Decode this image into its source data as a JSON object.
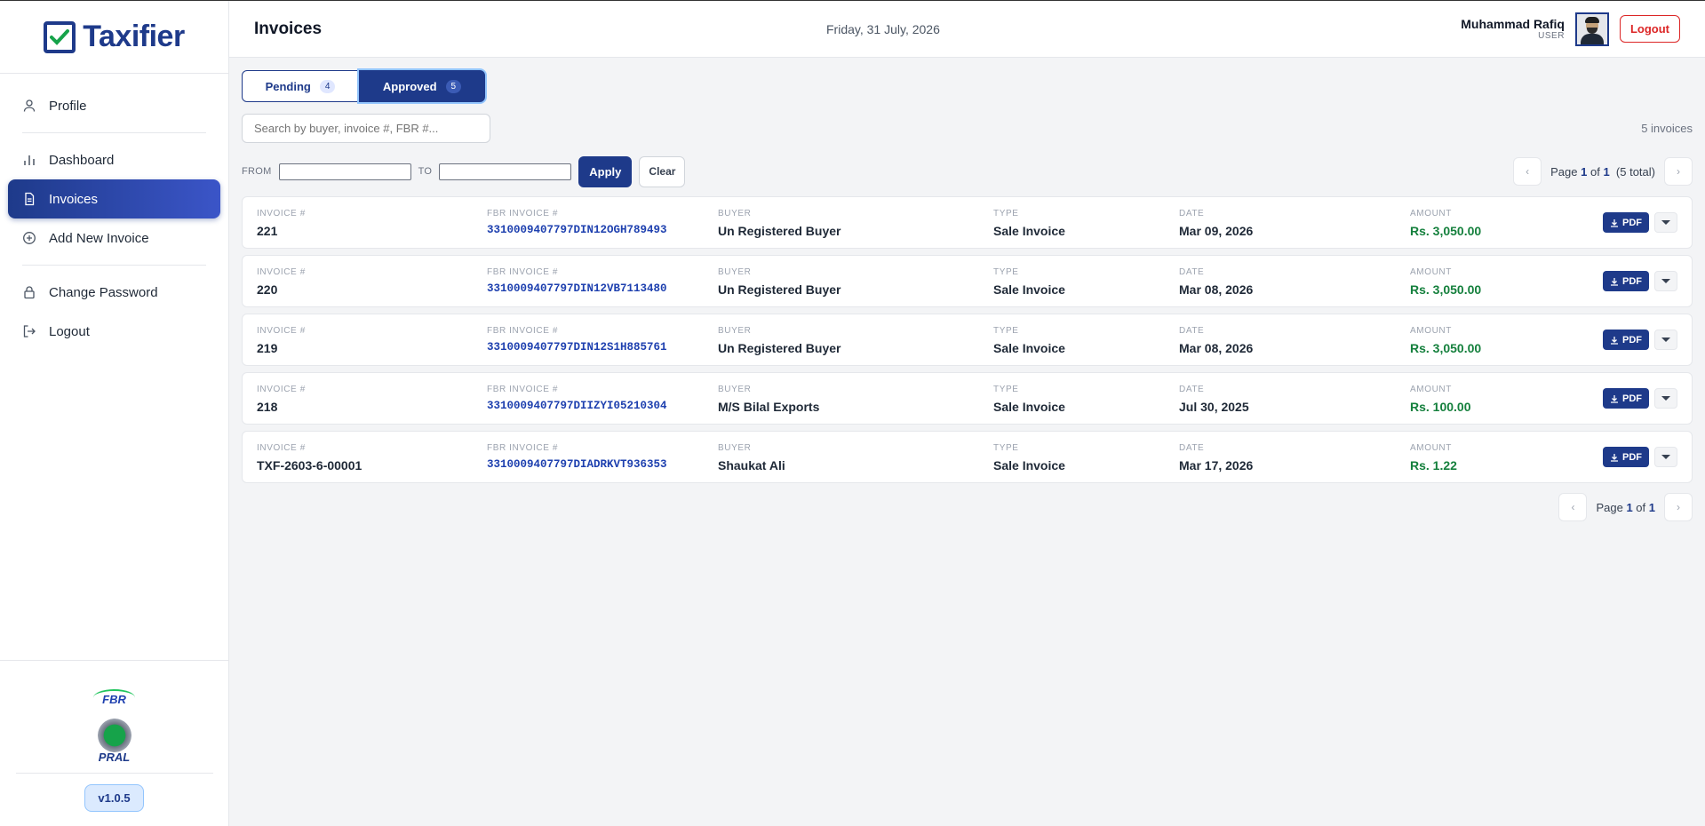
{
  "brand": {
    "name": "Taxifier",
    "version": "v1.0.5",
    "partner1": "FBR",
    "partner2": "PRAL"
  },
  "sidebar": {
    "items": [
      {
        "label": "Profile",
        "icon": "user-icon"
      },
      {
        "label": "Dashboard",
        "icon": "bar-chart-icon"
      },
      {
        "label": "Invoices",
        "icon": "document-icon",
        "active": true
      },
      {
        "label": "Add New Invoice",
        "icon": "plus-circle-icon"
      },
      {
        "label": "Change Password",
        "icon": "lock-icon"
      },
      {
        "label": "Logout",
        "icon": "logout-icon"
      }
    ]
  },
  "header": {
    "title": "Invoices",
    "date": "Friday, 31 July, 2026",
    "user_name": "Muhammad Rafiq",
    "user_role": "USER",
    "logout_label": "Logout"
  },
  "tabs": [
    {
      "label": "Pending",
      "count": "4"
    },
    {
      "label": "Approved",
      "count": "5",
      "active": true
    }
  ],
  "search": {
    "placeholder": "Search by buyer, invoice #, FBR #...",
    "count_text": "5 invoices"
  },
  "filter": {
    "from_label": "FROM",
    "to_label": "TO",
    "apply_label": "Apply",
    "clear_label": "Clear"
  },
  "pager_top": {
    "prefix": "Page",
    "page": "1",
    "of": "of",
    "total_pages": "1",
    "total_text": "(5 total)"
  },
  "pager_bottom": {
    "prefix": "Page",
    "page": "1",
    "of": "of",
    "total_pages": "1"
  },
  "columns": {
    "invoice": "INVOICE #",
    "fbr": "FBR INVOICE #",
    "buyer": "BUYER",
    "type": "TYPE",
    "date": "DATE",
    "amount": "AMOUNT"
  },
  "pdf_label": "PDF",
  "invoices": [
    {
      "invoice": "221",
      "fbr": "3310009407797DIN12OGH789493",
      "buyer": "Un Registered Buyer",
      "type": "Sale Invoice",
      "date": "Mar 09, 2026",
      "amount": "Rs. 3,050.00"
    },
    {
      "invoice": "220",
      "fbr": "3310009407797DIN12VB7113480",
      "buyer": "Un Registered Buyer",
      "type": "Sale Invoice",
      "date": "Mar 08, 2026",
      "amount": "Rs. 3,050.00"
    },
    {
      "invoice": "219",
      "fbr": "3310009407797DIN12S1H885761",
      "buyer": "Un Registered Buyer",
      "type": "Sale Invoice",
      "date": "Mar 08, 2026",
      "amount": "Rs. 3,050.00"
    },
    {
      "invoice": "218",
      "fbr": "3310009407797DIIZYI05210304",
      "buyer": "M/S Bilal Exports",
      "type": "Sale Invoice",
      "date": "Jul 30, 2025",
      "amount": "Rs. 100.00"
    },
    {
      "invoice": "TXF-2603-6-00001",
      "fbr": "3310009407797DIADRKVT936353",
      "buyer": "Shaukat Ali",
      "type": "Sale Invoice",
      "date": "Mar 17, 2026",
      "amount": "Rs. 1.22"
    }
  ]
}
